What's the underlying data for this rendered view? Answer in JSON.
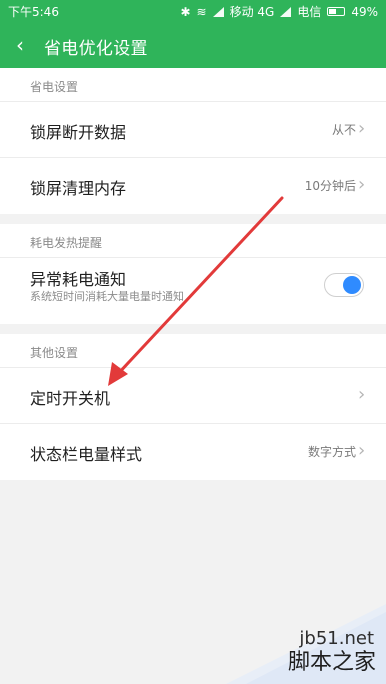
{
  "status": {
    "time": "下午5:46",
    "carrier1": "移动 4G",
    "carrier2": "电信",
    "battery": "49%"
  },
  "appbar": {
    "back_icon": "chevron-left",
    "title": "省电优化设置"
  },
  "sections": [
    {
      "header": "省电设置",
      "rows": [
        {
          "label": "锁屏断开数据",
          "value": "从不"
        },
        {
          "label": "锁屏清理内存",
          "value": "10分钟后"
        }
      ]
    },
    {
      "header": "耗电发热提醒",
      "rows": [
        {
          "label": "异常耗电通知",
          "sub": "系统短时间消耗大量电量时通知",
          "toggle": "on"
        }
      ]
    },
    {
      "header": "其他设置",
      "rows": [
        {
          "label": "定时开关机",
          "value": ""
        },
        {
          "label": "状态栏电量样式",
          "value": "数字方式"
        }
      ]
    }
  ],
  "watermark": {
    "site": "jb51.net",
    "name": "脚本之家"
  },
  "colors": {
    "brand": "#2fb45a",
    "toggle_on": "#2f8bff",
    "annotation_arrow": "#e23a3a"
  }
}
